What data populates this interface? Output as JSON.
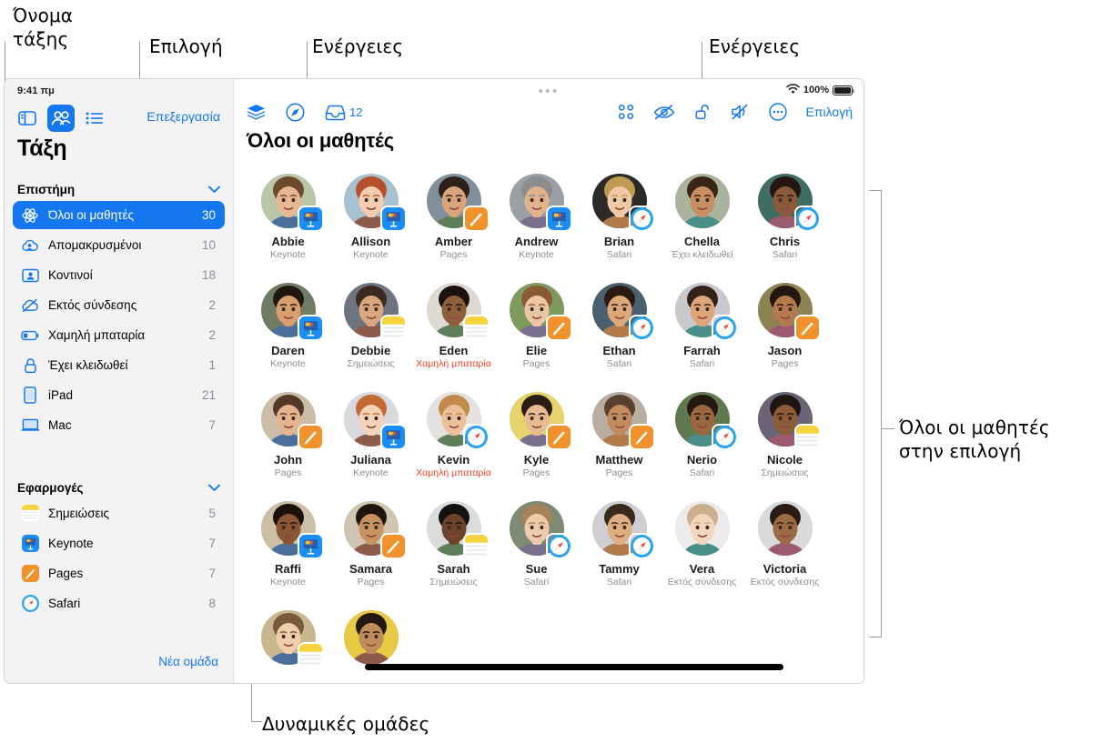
{
  "annotations": [
    {
      "id": "class-name",
      "text": "Όνομα\nτάξης"
    },
    {
      "id": "selection",
      "text": "Επιλογή"
    },
    {
      "id": "actions-left",
      "text": "Ενέργειες"
    },
    {
      "id": "actions-right",
      "text": "Ενέργειες"
    },
    {
      "id": "all-students-in-selection",
      "text": "Όλοι οι μαθητές\nστην επιλογή"
    },
    {
      "id": "dynamic-groups",
      "text": "Δυναμικές ομάδες"
    }
  ],
  "statusbar": {
    "time": "9:41 πμ",
    "battery_percent": "100%",
    "wifi_icon": "wifi-icon",
    "battery_icon": "battery-icon"
  },
  "sidebar": {
    "view_buttons": [
      {
        "name": "split-view-icon",
        "label": "",
        "active": false
      },
      {
        "name": "people-view-icon",
        "label": "",
        "active": true
      },
      {
        "name": "list-view-icon",
        "label": "",
        "active": false
      }
    ],
    "edit_label": "Επεξεργασία",
    "title": "Τάξη",
    "groups": [
      {
        "header": "Επιστήμη",
        "chevron": "chevron-down-icon",
        "items": [
          {
            "icon": "atom-icon",
            "label": "Όλοι οι μαθητές",
            "count": "30",
            "selected": true
          },
          {
            "icon": "cloud-person-icon",
            "label": "Απομακρυσμένοι",
            "count": "10",
            "selected": false
          },
          {
            "icon": "person-card-icon",
            "label": "Κοντινοί",
            "count": "18",
            "selected": false
          },
          {
            "icon": "cloud-slash-icon",
            "label": "Εκτός σύνδεσης",
            "count": "2",
            "selected": false
          },
          {
            "icon": "battery-low-icon",
            "label": "Χαμηλή μπαταρία",
            "count": "2",
            "selected": false
          },
          {
            "icon": "lock-icon",
            "label": "Έχει κλειδωθεί",
            "count": "1",
            "selected": false
          },
          {
            "icon": "ipad-icon",
            "label": "iPad",
            "count": "21",
            "selected": false
          },
          {
            "icon": "mac-icon",
            "label": "Mac",
            "count": "7",
            "selected": false
          }
        ]
      },
      {
        "header": "Εφαρμογές",
        "chevron": "chevron-down-icon",
        "items": [
          {
            "icon": "notes-app-icon",
            "label": "Σημειώσεις",
            "count": "5",
            "selected": false
          },
          {
            "icon": "keynote-app-icon",
            "label": "Keynote",
            "count": "7",
            "selected": false
          },
          {
            "icon": "pages-app-icon",
            "label": "Pages",
            "count": "7",
            "selected": false
          },
          {
            "icon": "safari-app-icon",
            "label": "Safari",
            "count": "8",
            "selected": false
          }
        ]
      }
    ],
    "new_group_label": "Νέα ομάδα"
  },
  "main": {
    "title": "Όλοι οι μαθητές",
    "toolbar_left": [
      {
        "name": "layers-icon",
        "badge": ""
      },
      {
        "name": "navigate-icon",
        "badge": ""
      },
      {
        "name": "inbox-icon",
        "badge": "12"
      }
    ],
    "toolbar_right": [
      {
        "name": "grid-apps-icon",
        "label": ""
      },
      {
        "name": "eye-slash-icon",
        "label": ""
      },
      {
        "name": "unlock-icon",
        "label": ""
      },
      {
        "name": "mute-icon",
        "label": ""
      },
      {
        "name": "more-circle-icon",
        "label": ""
      },
      {
        "name": "selection-text-button",
        "label": "Επιλογή"
      }
    ]
  },
  "students": [
    [
      {
        "name": "Abbie",
        "status": "Keynote",
        "badge": "keynote",
        "warn": false,
        "skin": "#e8b892",
        "hair": "#6b4a2f",
        "bg": "#b9c6a8"
      },
      {
        "name": "Allison",
        "status": "Keynote",
        "badge": "keynote",
        "warn": false,
        "skin": "#f3cdb0",
        "hair": "#b4502a",
        "bg": "#a8c0cf"
      },
      {
        "name": "Amber",
        "status": "Pages",
        "badge": "pages",
        "warn": false,
        "skin": "#d9a479",
        "hair": "#2e2119",
        "bg": "#7f8f9b"
      },
      {
        "name": "Andrew",
        "status": "Keynote",
        "badge": "keynote",
        "warn": false,
        "skin": "#e2b28c",
        "hair": "#8d8d8d",
        "bg": "#9aa0a5"
      },
      {
        "name": "Brian",
        "status": "Safari",
        "badge": "safari",
        "warn": false,
        "skin": "#f0c9a6",
        "hair": "#c09a55",
        "bg": "#2b2a26"
      },
      {
        "name": "Chella",
        "status": "Έχει κλειδωθεί",
        "badge": "",
        "warn": false,
        "skin": "#c98f63",
        "hair": "#3a2418",
        "bg": "#aab39c"
      },
      {
        "name": "Chris",
        "status": "Safari",
        "badge": "safari",
        "warn": false,
        "skin": "#8a5a3a",
        "hair": "#241610",
        "bg": "#3f6c63"
      }
    ],
    [
      {
        "name": "Daren",
        "status": "Keynote",
        "badge": "keynote",
        "warn": false,
        "skin": "#d99f6f",
        "hair": "#1f1710",
        "bg": "#6f7b62"
      },
      {
        "name": "Debbie",
        "status": "Σημειώσεις",
        "badge": "notes",
        "warn": false,
        "skin": "#d8a77f",
        "hair": "#3a2a1e",
        "bg": "#6d7480"
      },
      {
        "name": "Eden",
        "status": "Χαμηλή μπαταρία",
        "badge": "notes",
        "warn": true,
        "skin": "#8f5f3d",
        "hair": "#1c120c",
        "bg": "#ded9d2"
      },
      {
        "name": "Elie",
        "status": "Pages",
        "badge": "pages",
        "warn": false,
        "skin": "#eac6a4",
        "hair": "#8a5b32",
        "bg": "#7e9a5e"
      },
      {
        "name": "Ethan",
        "status": "Safari",
        "badge": "safari",
        "warn": false,
        "skin": "#dca878",
        "hair": "#2a1a12",
        "bg": "#49606e"
      },
      {
        "name": "Farrah",
        "status": "Safari",
        "badge": "safari",
        "warn": false,
        "skin": "#dda57a",
        "hair": "#33221a",
        "bg": "#c9c8cd"
      },
      {
        "name": "Jason",
        "status": "Pages",
        "badge": "pages",
        "warn": false,
        "skin": "#b4794c",
        "hair": "#241711",
        "bg": "#8d8352"
      }
    ],
    [
      {
        "name": "John",
        "status": "Pages",
        "badge": "pages",
        "warn": false,
        "skin": "#e5b48f",
        "hair": "#53382a",
        "bg": "#cbbda8"
      },
      {
        "name": "Juliana",
        "status": "Keynote",
        "badge": "keynote",
        "warn": false,
        "skin": "#f6d3b8",
        "hair": "#c36a32",
        "bg": "#d8d9de"
      },
      {
        "name": "Kevin",
        "status": "Χαμηλή μπαταρία",
        "badge": "safari",
        "warn": true,
        "skin": "#ebc09a",
        "hair": "#c08b48",
        "bg": "#e3e2e0"
      },
      {
        "name": "Kyle",
        "status": "Pages",
        "badge": "pages",
        "warn": false,
        "skin": "#e8bc93",
        "hair": "#2b1d14",
        "bg": "#e7d36b"
      },
      {
        "name": "Matthew",
        "status": "Pages",
        "badge": "pages",
        "warn": false,
        "skin": "#c48b60",
        "hair": "#5a4030",
        "bg": "#b8ada0"
      },
      {
        "name": "Nerio",
        "status": "Safari",
        "badge": "safari",
        "warn": false,
        "skin": "#9b6740",
        "hair": "#241810",
        "bg": "#5e7a4e"
      },
      {
        "name": "Nicole",
        "status": "Σημειώσεις",
        "badge": "notes",
        "warn": false,
        "skin": "#8d5c39",
        "hair": "#201510",
        "bg": "#6a6476"
      }
    ],
    [
      {
        "name": "Raffi",
        "status": "Keynote",
        "badge": "keynote",
        "warn": false,
        "skin": "#8a5736",
        "hair": "#1b110c",
        "bg": "#cdbfa6"
      },
      {
        "name": "Samara",
        "status": "Pages",
        "badge": "pages",
        "warn": false,
        "skin": "#c9935f",
        "hair": "#20160f",
        "bg": "#cfc5b2"
      },
      {
        "name": "Sarah",
        "status": "Σημειώσεις",
        "badge": "notes",
        "warn": false,
        "skin": "#6d4429",
        "hair": "#14100d",
        "bg": "#dcdcdf"
      },
      {
        "name": "Sue",
        "status": "Safari",
        "badge": "safari",
        "warn": false,
        "skin": "#f0cbab",
        "hair": "#a6825a",
        "bg": "#7d8a74"
      },
      {
        "name": "Tammy",
        "status": "Safari",
        "badge": "safari",
        "warn": false,
        "skin": "#dfae83",
        "hair": "#3a2a1d",
        "bg": "#cfcfd3"
      },
      {
        "name": "Vera",
        "status": "Εκτός σύνδεσης",
        "badge": "",
        "warn": false,
        "skin": "#f2d6be",
        "hair": "#c9b08a",
        "bg": "#eceaea"
      },
      {
        "name": "Victoria",
        "status": "Εκτός σύνδεσης",
        "badge": "",
        "warn": false,
        "skin": "#9c6a44",
        "hair": "#2a1c14",
        "bg": "#dadada"
      }
    ],
    [
      {
        "name": "",
        "status": "",
        "badge": "notes",
        "warn": false,
        "skin": "#f0cdab",
        "hair": "#7a5a3c",
        "bg": "#c9b78f"
      },
      {
        "name": "",
        "status": "",
        "badge": "",
        "warn": false,
        "skin": "#c08c5c",
        "hair": "#241812",
        "bg": "#e8c945"
      }
    ]
  ],
  "colors": {
    "accent": "#1477f0",
    "warn": "#f5442a",
    "sidebar_bg": "#f3f3f6",
    "secondary_text": "#8d8d93"
  }
}
